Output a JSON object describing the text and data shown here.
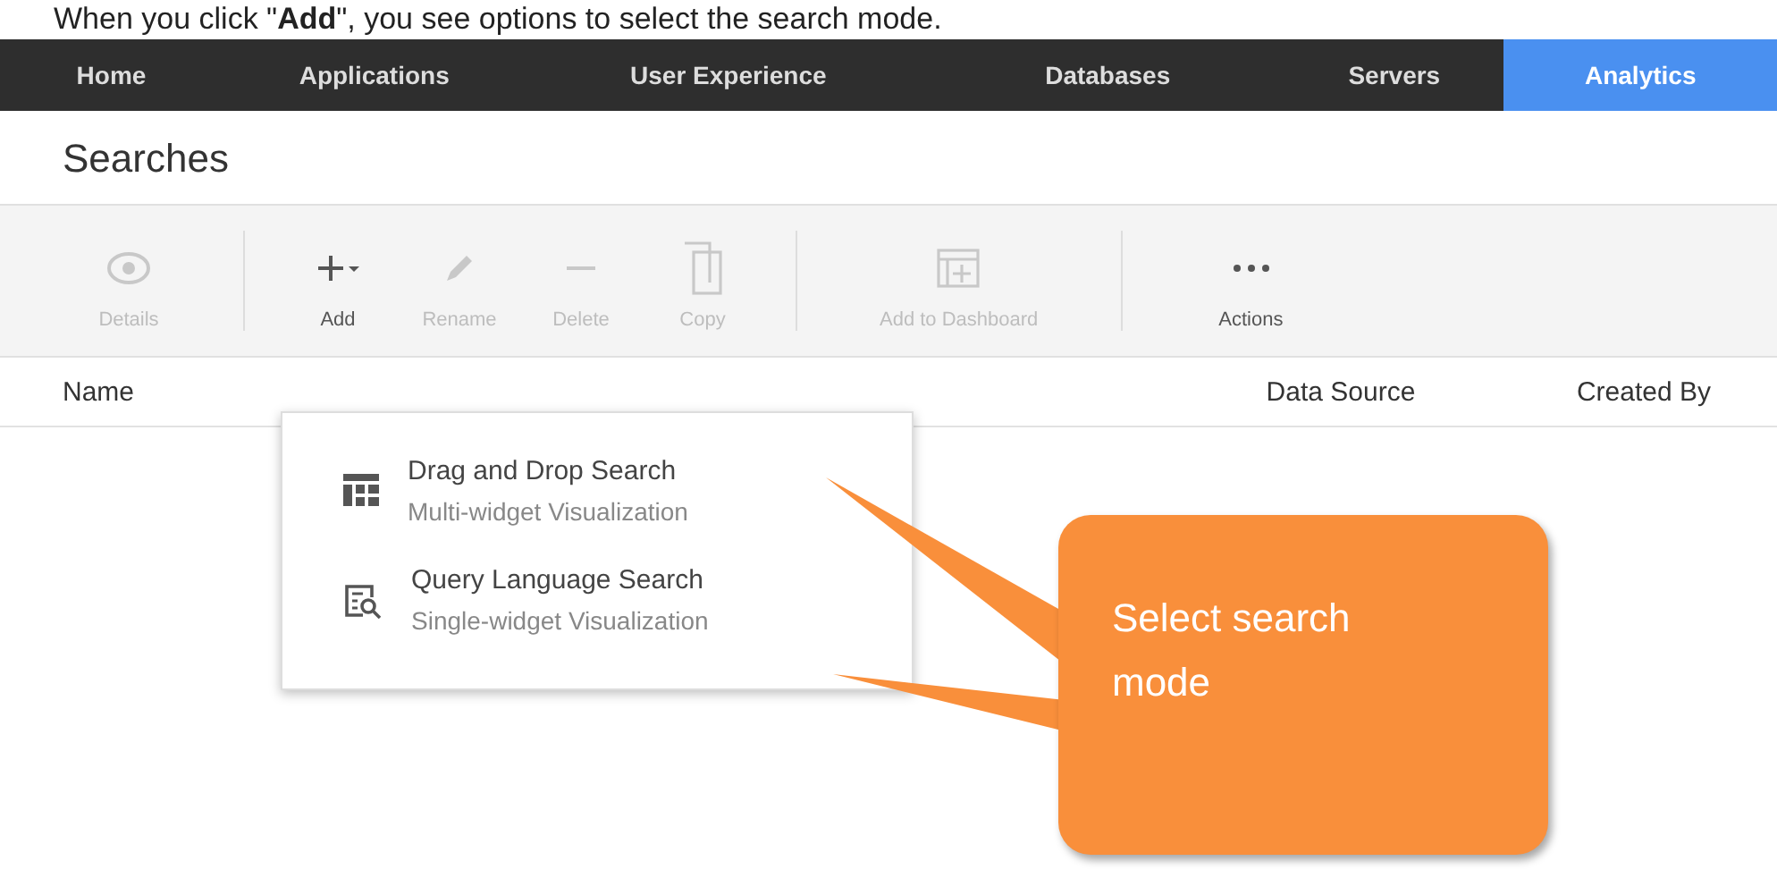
{
  "caption": "When you click \"**Add**\", you see options to select the search mode.",
  "nav": {
    "tabs": [
      {
        "label": "Home",
        "selected": false
      },
      {
        "label": "Applications",
        "selected": false
      },
      {
        "label": "User Experience",
        "selected": false
      },
      {
        "label": "Databases",
        "selected": false
      },
      {
        "label": "Servers",
        "selected": false
      },
      {
        "label": "Analytics",
        "selected": true
      }
    ]
  },
  "page_title": "Searches",
  "toolbar": {
    "groups": [
      {
        "items": [
          {
            "label": "Details",
            "disabled": true
          }
        ]
      },
      {
        "items": [
          {
            "label": "Add",
            "disabled": false
          },
          {
            "label": "Rename",
            "disabled": true
          },
          {
            "label": "Delete",
            "disabled": true
          },
          {
            "label": "Copy",
            "disabled": true
          }
        ]
      },
      {
        "items": [
          {
            "label": "Add to Dashboard",
            "disabled": true
          }
        ]
      },
      {
        "items": [
          {
            "label": "Actions",
            "disabled": false
          }
        ]
      }
    ]
  },
  "table": {
    "columns": [
      "Name",
      "Data Source",
      "Created By"
    ]
  },
  "add_menu": {
    "items": [
      {
        "title": "Drag and Drop Search",
        "subtitle": "Multi-widget Visualization"
      },
      {
        "title": "Query Language Search",
        "subtitle": "Single-widget Visualization"
      }
    ]
  },
  "callout": {
    "text": "Select search mode"
  }
}
